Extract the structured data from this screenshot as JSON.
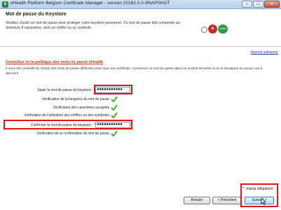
{
  "window": {
    "title": "eHealth Platform Belgium Certificate Manager - version 20162.0.0-SNAPSHOT",
    "minimize": "–",
    "maximize": "□",
    "close": "x"
  },
  "header": {
    "page_title": "Mot de passe du Keystore",
    "intro": "Veuillez choisir un mot de passe pour protéger votre keystore personnel. Ce mot de passe doit comporter au minimum 8 caractères, dont un chiffre ou un symbole.",
    "logo_middle": "e",
    "logo_right": "Health"
  },
  "links": {
    "manual": "Manuel utilisateur",
    "policy": "Consultez ici la politique des mots de passe eHealth"
  },
  "advice": "Il vous est conseillé de choisir des mots de passe différents pour tous vos certificats. Conservez ce mot de passe dans un endroit sécurisé et ne le divulguez en aucun cas à des tiers.",
  "form": {
    "password_label": "Saisir le mot de passe du keystore : *",
    "password_value": "●●●●●●●●●●●",
    "check_length": "Vérification de la longueur du mot de passe",
    "check_chars": "Vérification des caractères acceptés",
    "check_digits": "Vérification de l'utilisation des chiffres ou des symboles",
    "confirm_label": "Confirmer le mot de passe du keystore : *",
    "confirm_value": "●●●●●●●●●●●",
    "check_confirm": "Vérification de la confirmation du mot de passe"
  },
  "footer": {
    "required_note": "* champ obligatoire",
    "cancel": "Annuler",
    "previous": "< Précédent",
    "next": "Suivant >"
  },
  "colors": {
    "highlight": "#e0161b",
    "link": "#1d3ea8",
    "policy_link": "#c43b1b",
    "check": "#4cae37"
  }
}
